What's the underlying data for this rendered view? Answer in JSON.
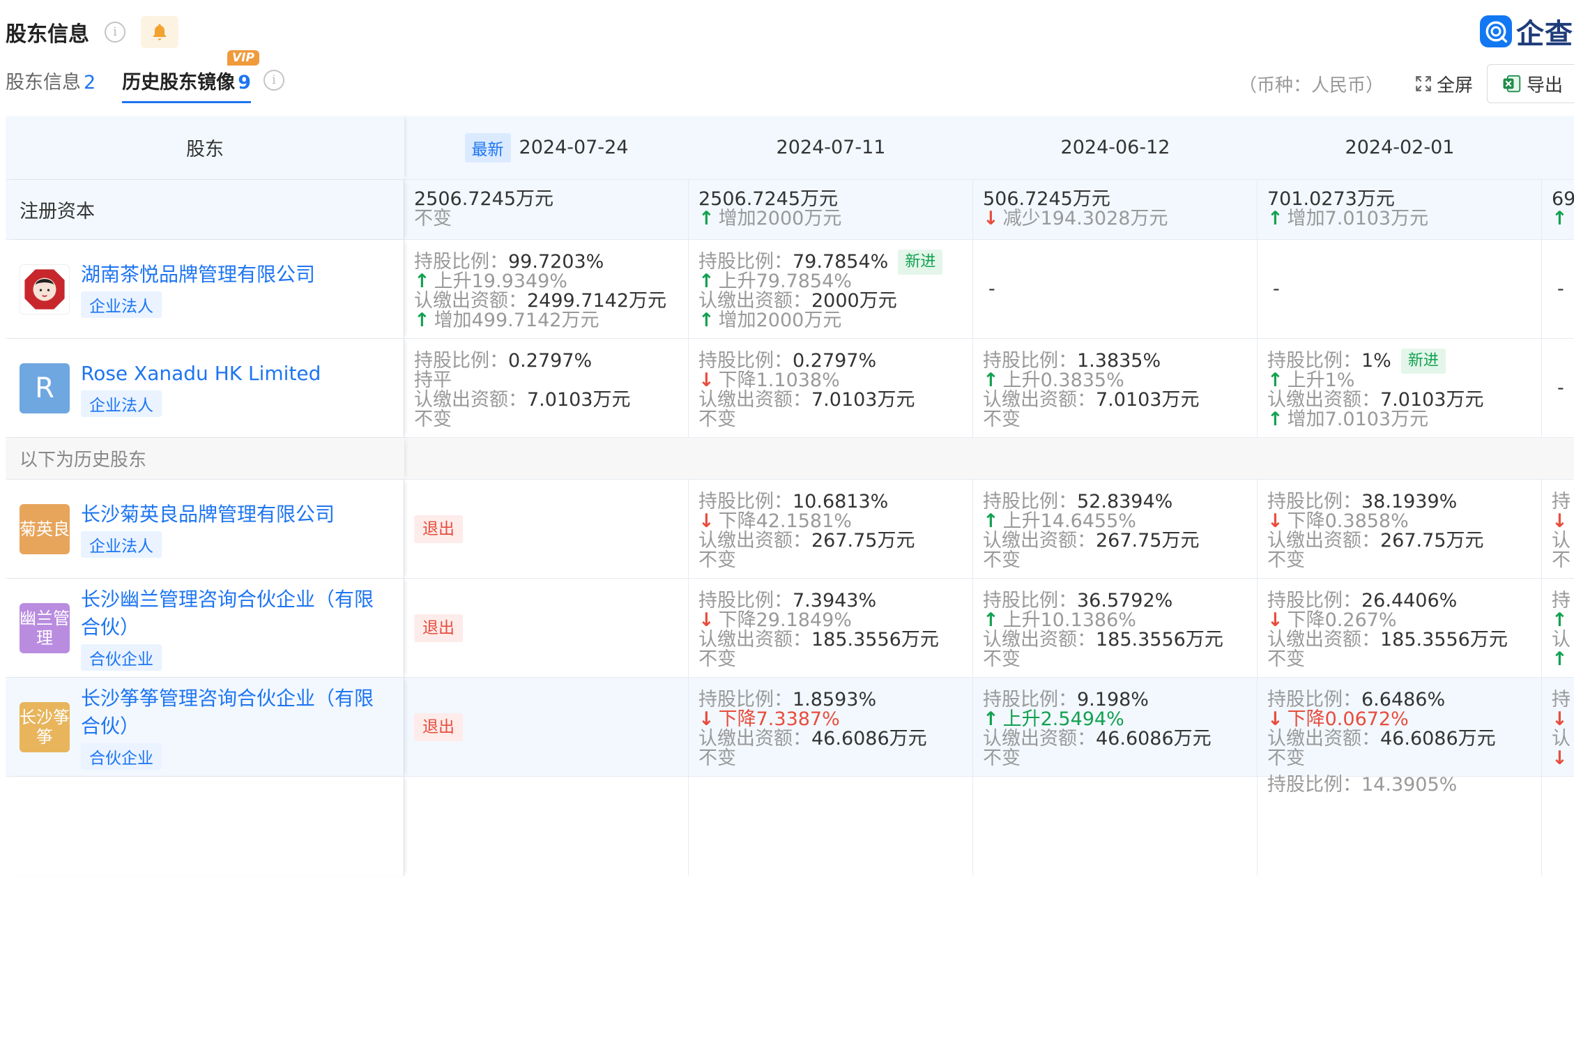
{
  "header": {
    "title": "股东信息",
    "info_glyph": "i",
    "logo_text": "企查查"
  },
  "tabs": [
    {
      "label": "股东信息",
      "count": "2"
    },
    {
      "label": "历史股东镜像",
      "count": "9",
      "badge": "VIP"
    }
  ],
  "toolbar": {
    "currency": "（币种：人民币）",
    "fullscreen_label": "全屏",
    "export_label": "导出"
  },
  "table": {
    "col0_header": "股东",
    "latest_badge": "最新",
    "dates": [
      "2024-07-24",
      "2024-07-11",
      "2024-06-12",
      "2024-02-01"
    ],
    "capital_label": "注册资本",
    "capital": [
      {
        "value": "2506.7245万元",
        "change": "不变"
      },
      {
        "value": "2506.7245万元",
        "change": "增加2000万元"
      },
      {
        "value": "506.7245万元",
        "change": "减少194.3028万元"
      },
      {
        "value": "701.0273万元",
        "change": "增加7.0103万元"
      },
      {
        "value": "69"
      }
    ],
    "ratio_key": "持股比例：",
    "amount_key": "认缴出资额：",
    "new_badge": "新进",
    "exit_badge": "退出",
    "dash": "-",
    "history_label": "以下为历史股东",
    "shareholders": [
      {
        "name": "湖南茶悦品牌管理有限公司",
        "tag": "企业法人",
        "avatar_text": "",
        "avatar_color": "#c8262d",
        "cells": [
          {
            "ratio": "99.7203%",
            "ratio_change": "上升19.9349%",
            "amount": "2499.7142万元",
            "amount_change": "增加499.7142万元"
          },
          {
            "ratio": "79.7854%",
            "ratio_change": "上升79.7854%",
            "amount": "2000万元",
            "amount_change": "增加2000万元"
          }
        ]
      },
      {
        "name": "Rose Xanadu HK Limited",
        "tag": "企业法人",
        "avatar_text": "R",
        "avatar_color": "#6fa7e0",
        "cells": [
          {
            "ratio": "0.2797%",
            "ratio_change": "持平",
            "amount": "7.0103万元",
            "amount_change": "不变"
          },
          {
            "ratio": "0.2797%",
            "ratio_change": "下降1.1038%",
            "amount": "7.0103万元",
            "amount_change": "不变"
          },
          {
            "ratio": "1.3835%",
            "ratio_change": "上升0.3835%",
            "amount": "7.0103万元",
            "amount_change": "不变"
          },
          {
            "ratio": "1%",
            "ratio_change": "上升1%",
            "amount": "7.0103万元",
            "amount_change": "增加7.0103万元"
          }
        ]
      },
      {
        "name": "长沙菊英良品牌管理有限公司",
        "tag": "企业法人",
        "avatar_text": "菊英良",
        "avatar_color": "#e7a45b",
        "cells": [
          {
            "ratio": "10.6813%",
            "ratio_change": "下降42.1581%",
            "amount": "267.75万元",
            "amount_change": "不变"
          },
          {
            "ratio": "52.8394%",
            "ratio_change": "上升14.6455%",
            "amount": "267.75万元",
            "amount_change": "不变"
          },
          {
            "ratio": "38.1939%",
            "ratio_change": "下降0.3858%",
            "amount": "267.75万元",
            "amount_change": "不变"
          }
        ],
        "partial": {
          "k1": "持",
          "k3": "认",
          "k4": "不"
        }
      },
      {
        "name": "长沙幽兰管理咨询合伙企业（有限合伙）",
        "tag": "合伙企业",
        "avatar_text": "幽兰管理",
        "avatar_color": "#b98ce0",
        "cells": [
          {
            "ratio": "7.3943%",
            "ratio_change": "下降29.1849%",
            "amount": "185.3556万元",
            "amount_change": "不变"
          },
          {
            "ratio": "36.5792%",
            "ratio_change": "上升10.1386%",
            "amount": "185.3556万元",
            "amount_change": "不变"
          },
          {
            "ratio": "26.4406%",
            "ratio_change": "下降0.267%",
            "amount": "185.3556万元",
            "amount_change": "不变"
          }
        ],
        "partial": {
          "k1": "持",
          "k3": "认"
        }
      },
      {
        "name": "长沙筝筝管理咨询合伙企业（有限合伙）",
        "tag": "合伙企业",
        "avatar_text": "长沙筝筝",
        "avatar_color": "#e8b55c",
        "cells": [
          {
            "ratio": "1.8593%",
            "ratio_change": "下降7.3387%",
            "amount": "46.6086万元",
            "amount_change": "不变"
          },
          {
            "ratio": "9.198%",
            "ratio_change": "上升2.5494%",
            "amount": "46.6086万元",
            "amount_change": "不变"
          },
          {
            "ratio": "6.6486%",
            "ratio_change": "下降0.0672%",
            "amount": "46.6086万元",
            "amount_change": "不变"
          }
        ],
        "partial": {
          "k1": "持",
          "k3": "认"
        }
      }
    ],
    "partial_next": "持股比例：14.3905%"
  },
  "colors": {
    "accent": "#1d75f2",
    "up": "#12a150",
    "down": "#e84c3d",
    "header_bg": "#f2f8fe",
    "vip": "#f09a3c"
  }
}
